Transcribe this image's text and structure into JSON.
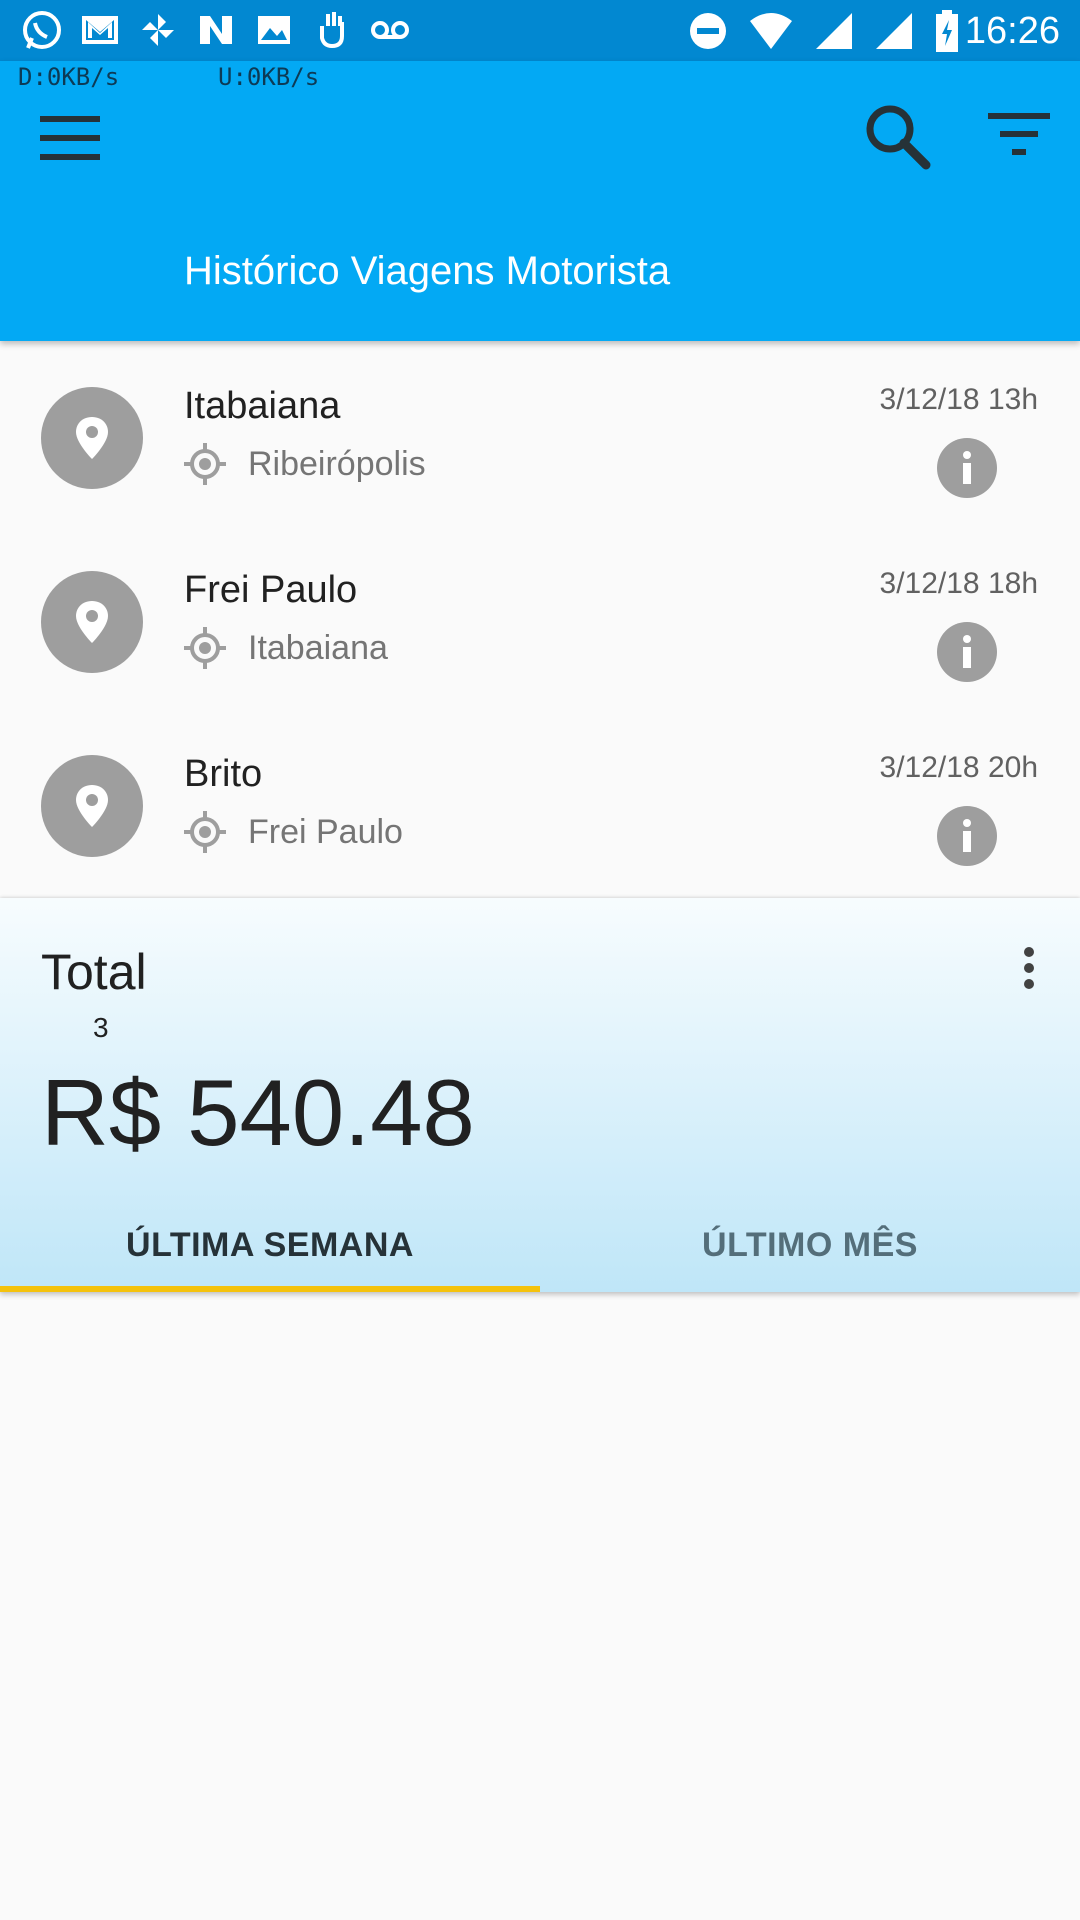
{
  "status_bar": {
    "time": "16:26",
    "left_icons": [
      "whatsapp-icon",
      "gmail-icon",
      "pinwheel-icon",
      "n-app-icon",
      "image-icon",
      "hand-icon",
      "voicemail-icon"
    ],
    "right_icons": [
      "do-not-disturb-icon",
      "wifi-icon",
      "signal-icon",
      "signal-icon",
      "battery-charging-icon"
    ]
  },
  "net_speed": {
    "download": "D:0KB/s",
    "upload": "U:0KB/s"
  },
  "app_bar": {
    "title": "Histórico Viagens Motorista",
    "icons": [
      "menu-icon",
      "search-icon",
      "filter-icon"
    ],
    "color": "#03a9f4"
  },
  "trips": [
    {
      "destination": "Itabaiana",
      "origin": "Ribeirópolis",
      "date": "3/12/18 13h"
    },
    {
      "destination": "Frei Paulo",
      "origin": "Itabaiana",
      "date": "3/12/18 18h"
    },
    {
      "destination": "Brito",
      "origin": "Frei Paulo",
      "date": "3/12/18 20h"
    }
  ],
  "summary": {
    "label": "Total",
    "count": "3",
    "amount": "R$ 540.48",
    "tabs": [
      {
        "label": "ÚLTIMA SEMANA",
        "active": true
      },
      {
        "label": "ÚLTIMO MÊS",
        "active": false
      }
    ],
    "indicator_color": "#f4c20d"
  }
}
